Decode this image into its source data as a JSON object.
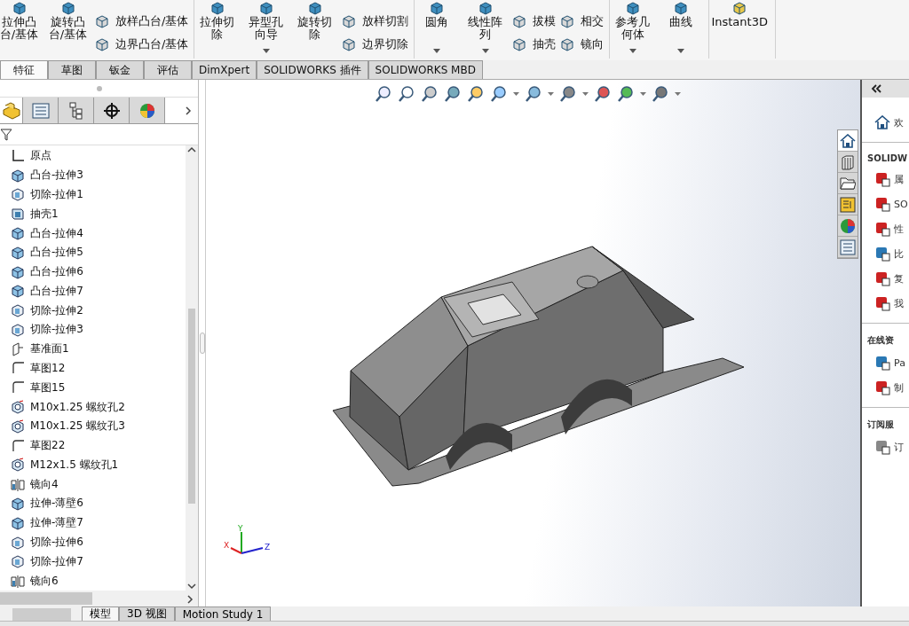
{
  "toolbar": {
    "groups": [
      {
        "large": [
          {
            "label": "拉伸凸台/基体",
            "dropdown": false
          },
          {
            "label": "旋转凸台/基体",
            "dropdown": false
          }
        ],
        "small_columns": [
          [
            "放样凸台/基体",
            "边界凸台/基体"
          ]
        ]
      },
      {
        "large": [
          {
            "label": "拉伸切除",
            "dropdown": false
          },
          {
            "label": "异型孔向导",
            "dropdown": true
          },
          {
            "label": "旋转切除",
            "dropdown": false
          }
        ],
        "small_columns": [
          [
            "放样切割",
            "边界切除"
          ]
        ]
      },
      {
        "large": [
          {
            "label": "圆角",
            "dropdown": true
          },
          {
            "label": "线性阵列",
            "dropdown": true
          }
        ],
        "small_columns": [
          [
            "拔模",
            "抽壳"
          ],
          [
            "相交",
            "镜向"
          ]
        ]
      },
      {
        "large": [
          {
            "label": "参考几何体",
            "dropdown": true
          },
          {
            "label": "曲线",
            "dropdown": true
          }
        ]
      },
      {
        "large": [
          {
            "label": "Instant3D",
            "dropdown": false
          }
        ]
      }
    ]
  },
  "command_tabs": [
    {
      "label": "特征",
      "selected": true
    },
    {
      "label": "草图",
      "selected": false
    },
    {
      "label": "钣金",
      "selected": false
    },
    {
      "label": "评估",
      "selected": false
    },
    {
      "label": "DimXpert",
      "selected": false
    },
    {
      "label": "SOLIDWORKS 插件",
      "selected": false
    },
    {
      "label": "SOLIDWORKS MBD",
      "selected": false
    }
  ],
  "manager_tabs": [
    {
      "selected": true
    },
    {
      "selected": false
    },
    {
      "selected": false
    },
    {
      "selected": false
    },
    {
      "selected": false
    }
  ],
  "feature_tree": [
    {
      "kind": "origin",
      "label": "原点"
    },
    {
      "kind": "extrude",
      "label": "凸台-拉伸3"
    },
    {
      "kind": "cut",
      "label": "切除-拉伸1"
    },
    {
      "kind": "shell",
      "label": "抽壳1"
    },
    {
      "kind": "extrude",
      "label": "凸台-拉伸4"
    },
    {
      "kind": "extrude",
      "label": "凸台-拉伸5"
    },
    {
      "kind": "extrude",
      "label": "凸台-拉伸6"
    },
    {
      "kind": "extrude",
      "label": "凸台-拉伸7"
    },
    {
      "kind": "cut",
      "label": "切除-拉伸2"
    },
    {
      "kind": "cut",
      "label": "切除-拉伸3"
    },
    {
      "kind": "plane",
      "label": "基准面1"
    },
    {
      "kind": "sketch",
      "label": "草图12"
    },
    {
      "kind": "sketch",
      "label": "草图15"
    },
    {
      "kind": "hole",
      "label": "M10x1.25 螺纹孔2"
    },
    {
      "kind": "hole",
      "label": "M10x1.25 螺纹孔3"
    },
    {
      "kind": "sketch",
      "label": "草图22"
    },
    {
      "kind": "hole",
      "label": "M12x1.5 螺纹孔1"
    },
    {
      "kind": "mirror",
      "label": "镜向4"
    },
    {
      "kind": "extrude",
      "label": "拉伸-薄壁6"
    },
    {
      "kind": "extrude",
      "label": "拉伸-薄壁7"
    },
    {
      "kind": "cut",
      "label": "切除-拉伸6"
    },
    {
      "kind": "cut",
      "label": "切除-拉伸7"
    },
    {
      "kind": "mirror",
      "label": "镜向6"
    }
  ],
  "triad": {
    "labels": [
      "Y",
      "X",
      "Z"
    ]
  },
  "task_tabs": [
    {
      "selected": true
    },
    {
      "selected": false
    },
    {
      "selected": false
    },
    {
      "selected": false
    },
    {
      "selected": false
    },
    {
      "selected": false
    }
  ],
  "task_pane": {
    "home": "欢",
    "sections": [
      {
        "title": "SOLIDW",
        "items": [
          "属",
          "SO",
          "性",
          "比",
          "复",
          "我"
        ]
      },
      {
        "title": "在线资",
        "items": [
          "Pa",
          "制"
        ]
      },
      {
        "title": "订阅服",
        "items": [
          "订"
        ]
      }
    ]
  },
  "bottom_tabs": [
    {
      "label": "模型",
      "selected": true
    },
    {
      "label": "3D 视图",
      "selected": false
    },
    {
      "label": "Motion Study 1",
      "selected": false
    }
  ]
}
